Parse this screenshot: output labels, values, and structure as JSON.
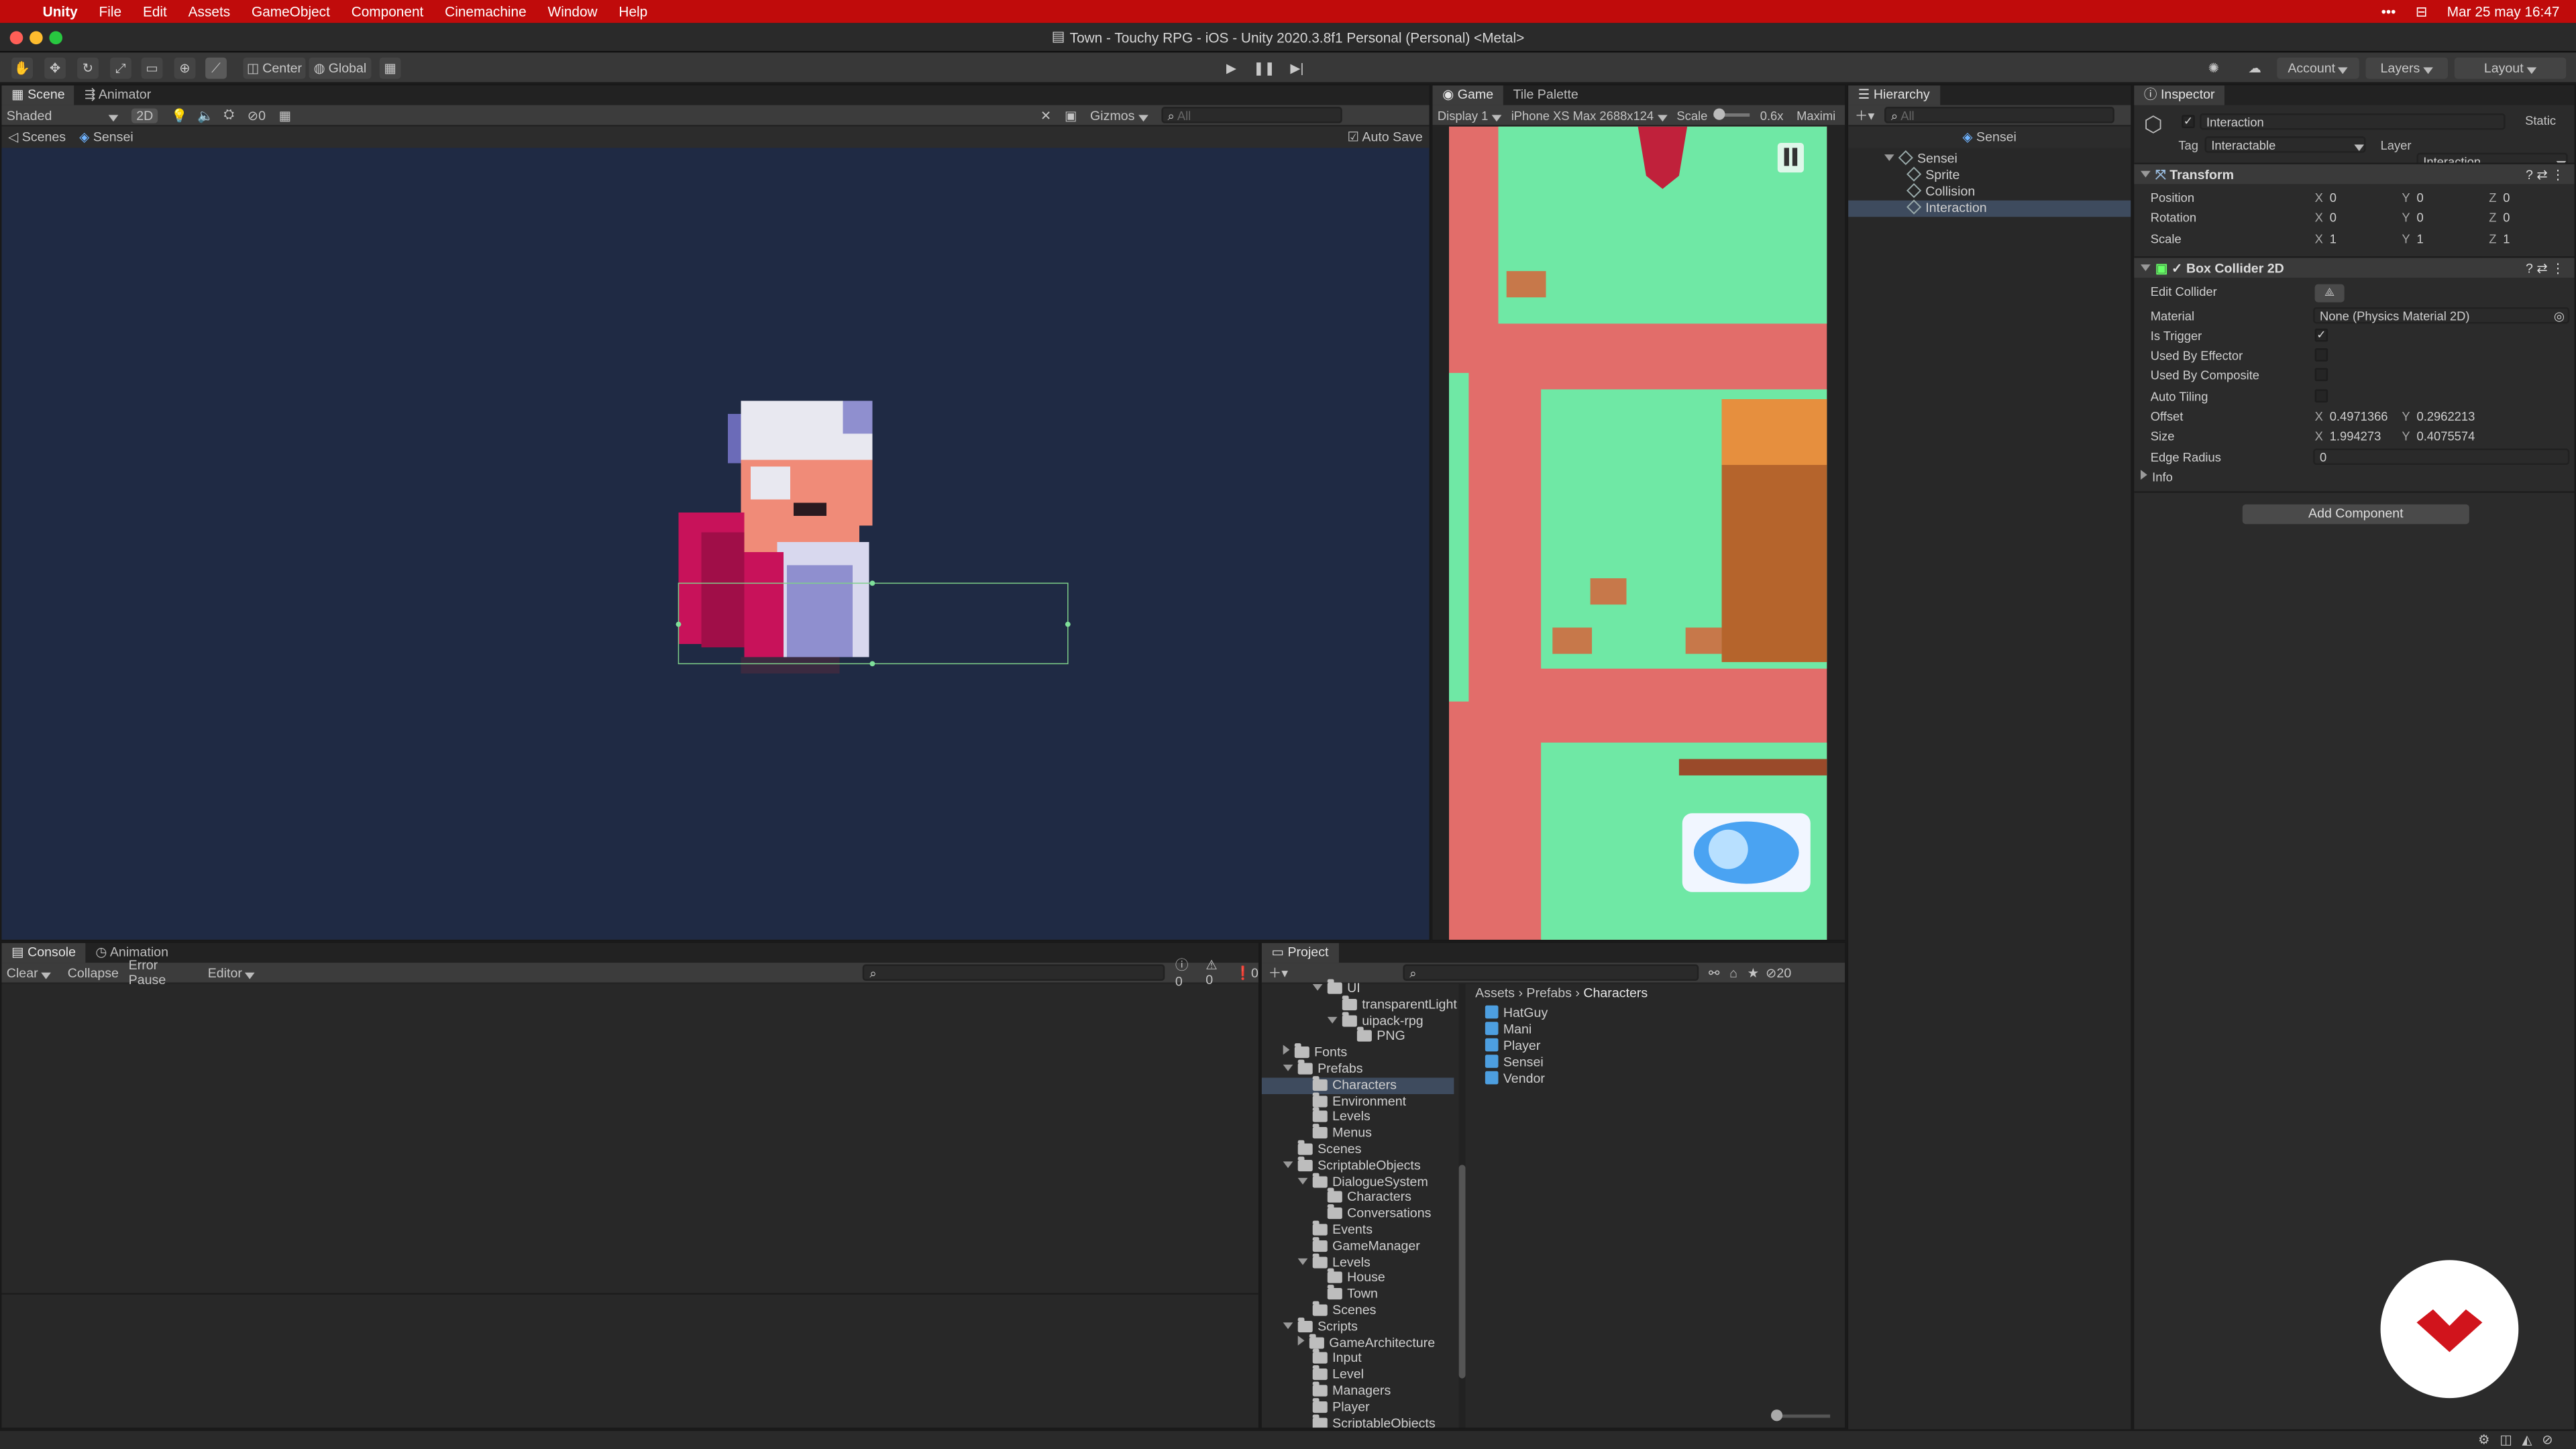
{
  "menubar": {
    "apple": "",
    "items": [
      "Unity",
      "File",
      "Edit",
      "Assets",
      "GameObject",
      "Component",
      "Cinemachine",
      "Window",
      "Help"
    ],
    "clock": "Mar 25 may  16:47"
  },
  "window": {
    "title": "Town - Touchy RPG - iOS - Unity 2020.3.8f1 Personal (Personal) <Metal>"
  },
  "toolbar": {
    "pivot": "Center",
    "space": "Global",
    "account": "Account",
    "layers": "Layers",
    "layout": "Layout"
  },
  "scene": {
    "tabs": [
      "Scene",
      "Animator"
    ],
    "shading": "Shaded",
    "mode2d": "2D",
    "gizmo_count": "0",
    "gizmos": "Gizmos",
    "search_placeholder": "All",
    "breadcrumb_root": "Scenes",
    "breadcrumb_item": "Sensei",
    "auto_save": "Auto Save"
  },
  "game": {
    "tabs": [
      "Game",
      "Tile Palette"
    ],
    "display": "Display 1",
    "resolution": "iPhone XS Max 2688x124",
    "scale_label": "Scale",
    "scale_value": "0.6x",
    "maximize": "Maximi"
  },
  "hierarchy": {
    "tab": "Hierarchy",
    "search_placeholder": "All",
    "root": "Sensei",
    "items": [
      "Sensei",
      "Sprite",
      "Collision",
      "Interaction"
    ]
  },
  "inspector": {
    "tab": "Inspector",
    "object_name": "Interaction",
    "static_label": "Static",
    "tag_label": "Tag",
    "tag_value": "Interactable",
    "layer_label": "Layer",
    "layer_value": "Interaction",
    "transform": {
      "title": "Transform",
      "rows": [
        {
          "label": "Position",
          "x": "0",
          "y": "0",
          "z": "0"
        },
        {
          "label": "Rotation",
          "x": "0",
          "y": "0",
          "z": "0"
        },
        {
          "label": "Scale",
          "x": "1",
          "y": "1",
          "z": "1"
        }
      ]
    },
    "box_collider": {
      "title": "Box Collider 2D",
      "edit_collider": "Edit Collider",
      "material_label": "Material",
      "material_value": "None (Physics Material 2D)",
      "is_trigger": "Is Trigger",
      "used_by_effector": "Used By Effector",
      "used_by_composite": "Used By Composite",
      "auto_tiling": "Auto Tiling",
      "offset_label": "Offset",
      "offset_x": "0.4971366",
      "offset_y": "0.2962213",
      "size_label": "Size",
      "size_x": "1.994273",
      "size_y": "0.4075574",
      "edge_radius_label": "Edge Radius",
      "edge_radius_value": "0",
      "info_label": "Info"
    },
    "add_component": "Add Component"
  },
  "console": {
    "tabs": [
      "Console",
      "Animation"
    ],
    "clear": "Clear",
    "collapse": "Collapse",
    "error_pause": "Error Pause",
    "editor": "Editor",
    "count_log": "0",
    "count_warn": "0",
    "count_err": "0"
  },
  "project": {
    "tab": "Project",
    "count": "20",
    "breadcrumb": [
      "Assets",
      "Prefabs",
      "Characters"
    ],
    "tree": [
      {
        "label": "UI",
        "depth": 3,
        "arrow": "down"
      },
      {
        "label": "transparentLight",
        "depth": 4,
        "arrow": ""
      },
      {
        "label": "uipack-rpg",
        "depth": 4,
        "arrow": "down"
      },
      {
        "label": "PNG",
        "depth": 5,
        "arrow": ""
      },
      {
        "label": "Fonts",
        "depth": 1,
        "arrow": "right"
      },
      {
        "label": "Prefabs",
        "depth": 1,
        "arrow": "down"
      },
      {
        "label": "Characters",
        "depth": 2,
        "arrow": "",
        "selected": true
      },
      {
        "label": "Environment",
        "depth": 2,
        "arrow": ""
      },
      {
        "label": "Levels",
        "depth": 2,
        "arrow": ""
      },
      {
        "label": "Menus",
        "depth": 2,
        "arrow": ""
      },
      {
        "label": "Scenes",
        "depth": 1,
        "arrow": ""
      },
      {
        "label": "ScriptableObjects",
        "depth": 1,
        "arrow": "down"
      },
      {
        "label": "DialogueSystem",
        "depth": 2,
        "arrow": "down"
      },
      {
        "label": "Characters",
        "depth": 3,
        "arrow": ""
      },
      {
        "label": "Conversations",
        "depth": 3,
        "arrow": ""
      },
      {
        "label": "Events",
        "depth": 2,
        "arrow": ""
      },
      {
        "label": "GameManager",
        "depth": 2,
        "arrow": ""
      },
      {
        "label": "Levels",
        "depth": 2,
        "arrow": "down"
      },
      {
        "label": "House",
        "depth": 3,
        "arrow": ""
      },
      {
        "label": "Town",
        "depth": 3,
        "arrow": ""
      },
      {
        "label": "Scenes",
        "depth": 2,
        "arrow": ""
      },
      {
        "label": "Scripts",
        "depth": 1,
        "arrow": "down"
      },
      {
        "label": "GameArchitecture",
        "depth": 2,
        "arrow": "right"
      },
      {
        "label": "Input",
        "depth": 2,
        "arrow": ""
      },
      {
        "label": "Level",
        "depth": 2,
        "arrow": ""
      },
      {
        "label": "Managers",
        "depth": 2,
        "arrow": ""
      },
      {
        "label": "Player",
        "depth": 2,
        "arrow": ""
      },
      {
        "label": "ScriptableObjects",
        "depth": 2,
        "arrow": ""
      }
    ],
    "assets": [
      "HatGuy",
      "Mani",
      "Player",
      "Sensei",
      "Vendor"
    ]
  },
  "colors": {
    "mac_bar": "#c00b0b",
    "selection": "#3e4b5e",
    "scene_bg": "#1f2a44",
    "grass": "#6fe8a5",
    "dirt": "#e26d6a",
    "accent_logo": "#d1141c"
  }
}
